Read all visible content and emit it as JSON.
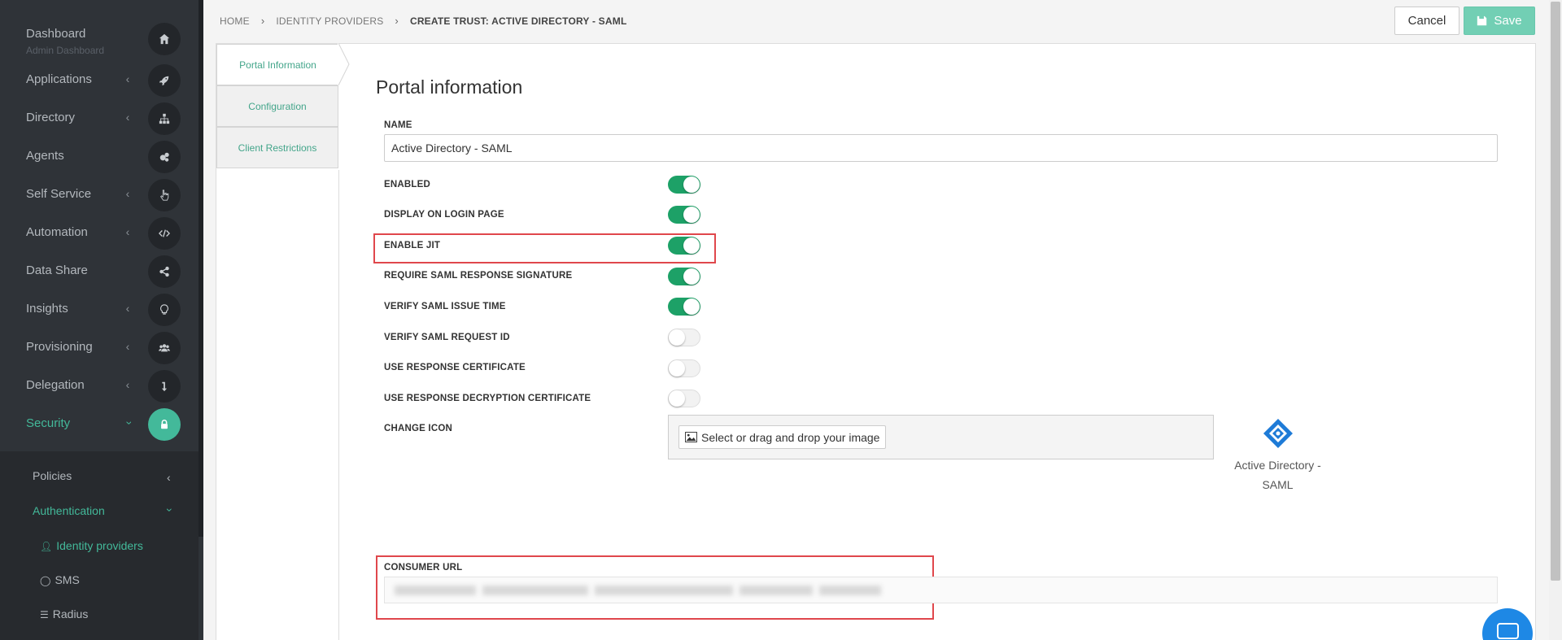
{
  "sidebar": {
    "items": [
      {
        "label": "Dashboard",
        "sublabel": "Admin Dashboard",
        "icon": "home-icon",
        "has_chevron": false
      },
      {
        "label": "Applications",
        "icon": "rocket-icon",
        "has_chevron": true
      },
      {
        "label": "Directory",
        "icon": "sitemap-icon",
        "has_chevron": true
      },
      {
        "label": "Agents",
        "icon": "cogs-icon",
        "has_chevron": false
      },
      {
        "label": "Self Service",
        "icon": "hand-pointer-icon",
        "has_chevron": true
      },
      {
        "label": "Automation",
        "icon": "code-icon",
        "has_chevron": true
      },
      {
        "label": "Data Share",
        "icon": "share-icon",
        "has_chevron": false
      },
      {
        "label": "Insights",
        "icon": "lightbulb-icon",
        "has_chevron": true
      },
      {
        "label": "Provisioning",
        "icon": "users-icon",
        "has_chevron": true
      },
      {
        "label": "Delegation",
        "icon": "level-down-icon",
        "has_chevron": true
      },
      {
        "label": "Security",
        "icon": "lock-icon",
        "has_chevron": true,
        "active": true
      }
    ],
    "subnav": {
      "policies": "Policies",
      "authentication": "Authentication",
      "identity_providers": "Identity providers",
      "sms": "SMS",
      "radius": "Radius"
    },
    "accent_color": "#43b99a"
  },
  "breadcrumb": [
    "HOME",
    "IDENTITY PROVIDERS",
    "CREATE TRUST: ACTIVE DIRECTORY - SAML"
  ],
  "toolbar": {
    "cancel_label": "Cancel",
    "save_label": "Save"
  },
  "tabs": [
    "Portal Information",
    "Configuration",
    "Client Restrictions"
  ],
  "form": {
    "title": "Portal information",
    "name_label": "NAME",
    "name_value": "Active Directory - SAML",
    "toggles": [
      {
        "label": "ENABLED",
        "on": true
      },
      {
        "label": "DISPLAY ON LOGIN PAGE",
        "on": true
      },
      {
        "label": "ENABLE JIT",
        "on": true
      },
      {
        "label": "REQUIRE SAML RESPONSE SIGNATURE",
        "on": true
      },
      {
        "label": "VERIFY SAML ISSUE TIME",
        "on": true
      },
      {
        "label": "VERIFY SAML REQUEST ID",
        "on": false
      },
      {
        "label": "USE RESPONSE CERTIFICATE",
        "on": false
      },
      {
        "label": "USE RESPONSE DECRYPTION CERTIFICATE",
        "on": false
      }
    ],
    "change_icon_label": "CHANGE ICON",
    "upload_label": "Select or drag and drop your image",
    "preview_name_line1": "Active Directory -",
    "preview_name_line2": "SAML",
    "consumer_url_label": "CONSUMER URL"
  },
  "toggle_on_color": "#1da167",
  "highlight_color": "#e0474c"
}
